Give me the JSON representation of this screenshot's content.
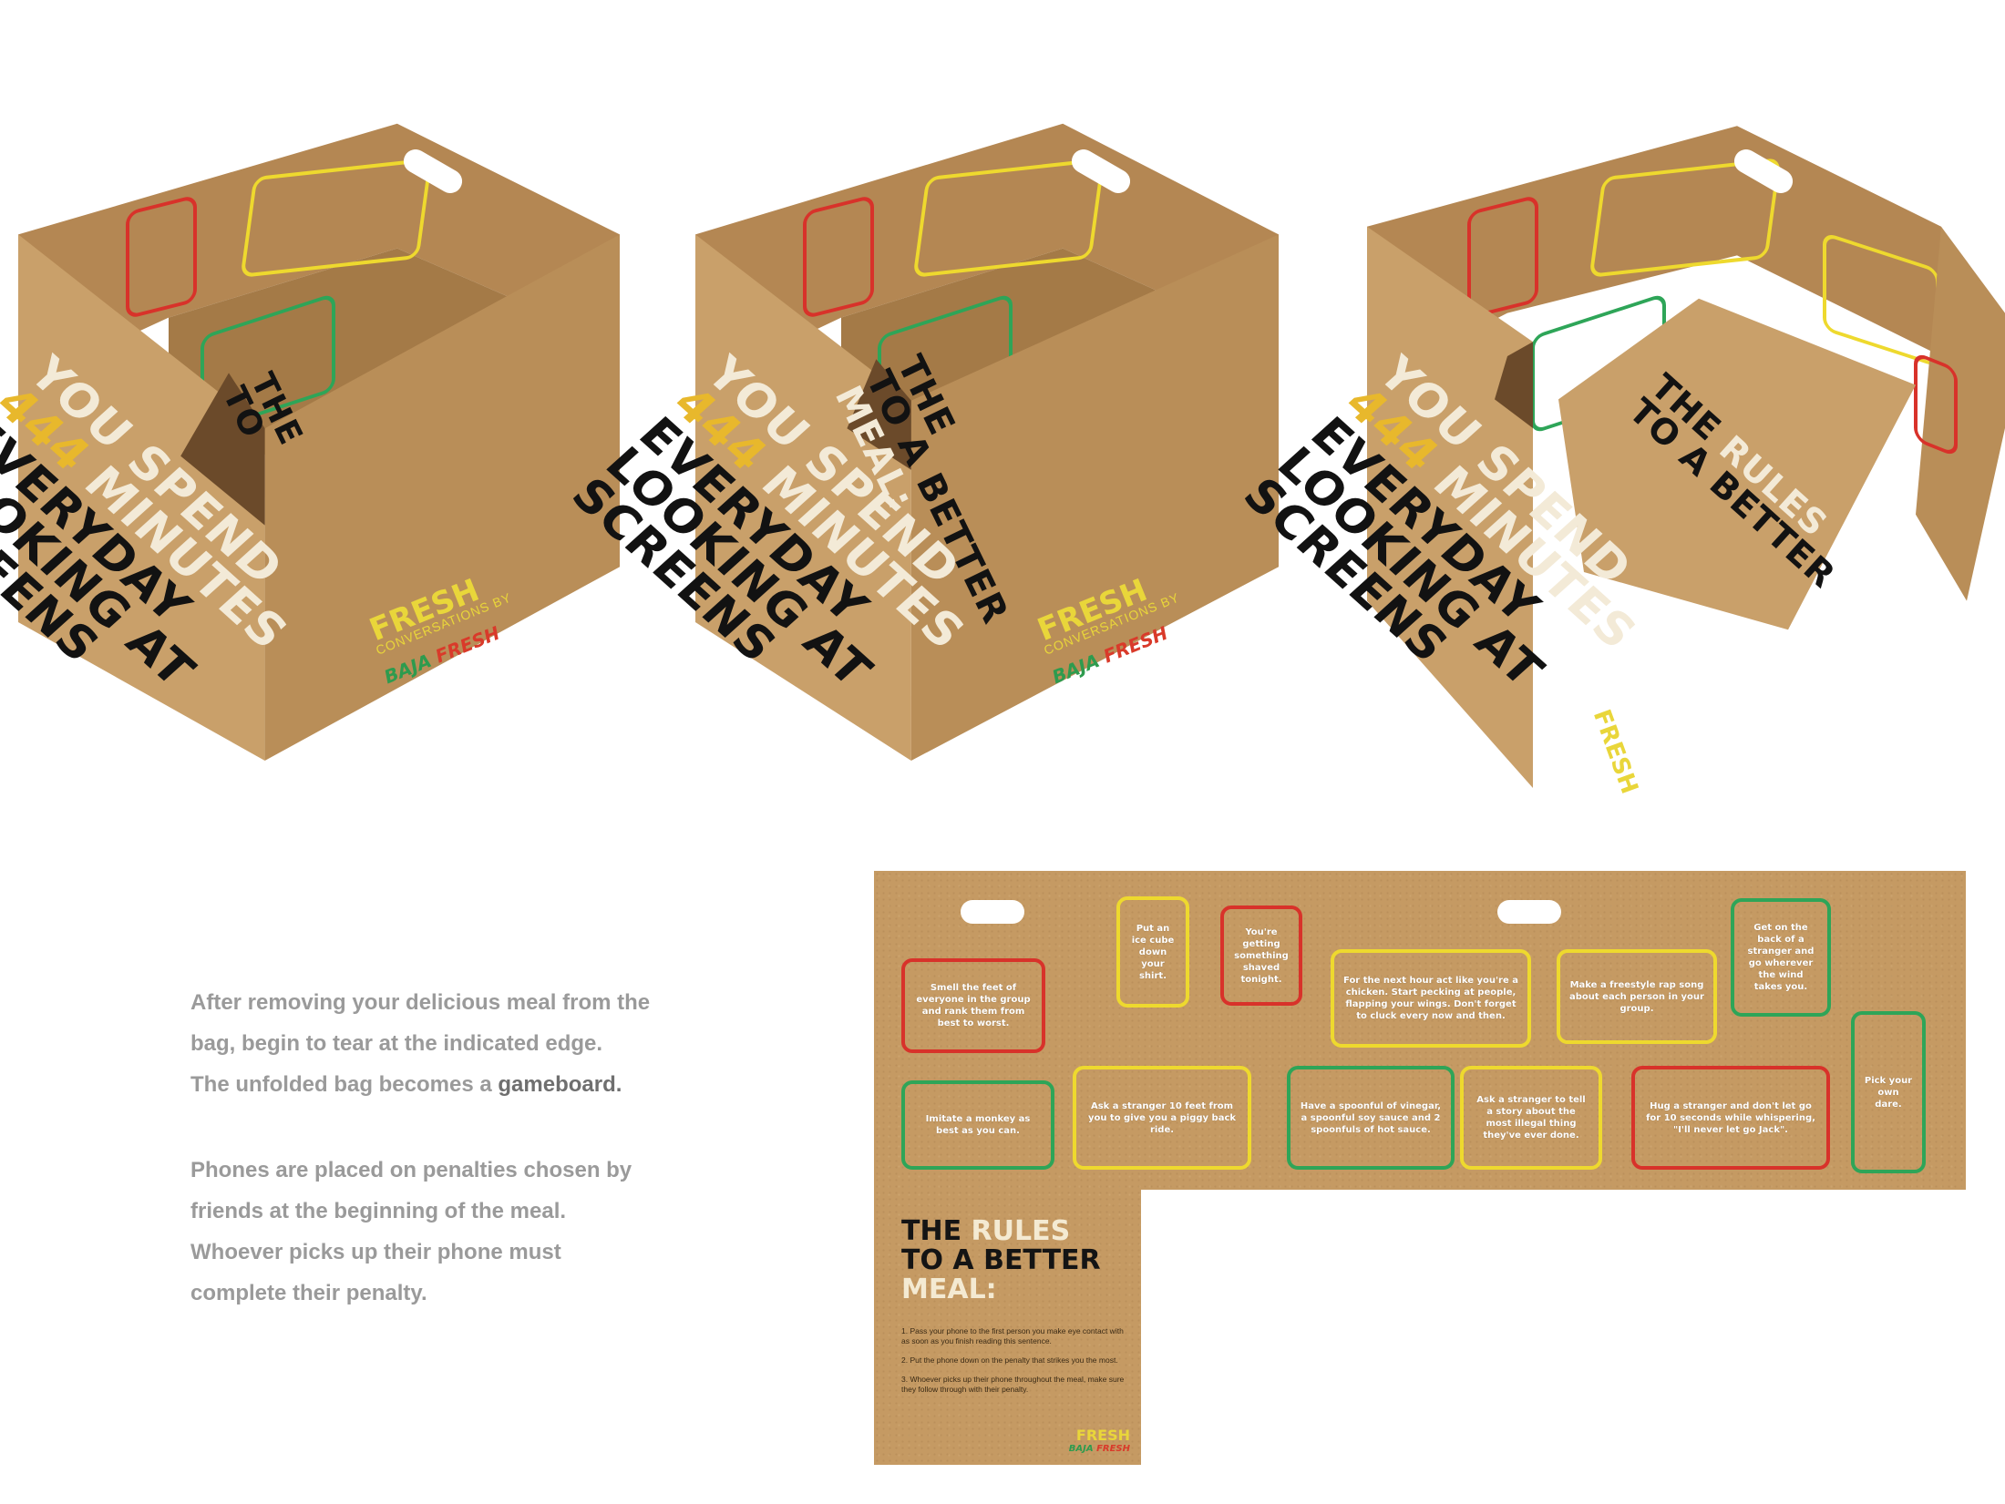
{
  "box_panel": {
    "headline_line1": "YOU SPEND",
    "headline_number": "444",
    "headline_line2": "MINUTES",
    "headline_line3": "EVERYDAY",
    "headline_line4": "LOOKING AT",
    "headline_line5": "SCREENS",
    "logo_fresh": "FRESH",
    "logo_sub": "CONVERSATIONS BY",
    "logo_baja": "BAJA",
    "logo_baja_fresh": "FRESH",
    "inner_title_the": "THE",
    "inner_title_to": "TO",
    "inner_title_rules": "RULES",
    "inner_title_better": "TO A BETTER",
    "inner_title_meal": "MEAL:"
  },
  "description": {
    "para1_lines": [
      "After removing your delicious meal from the",
      "bag, begin to tear at the indicated edge.",
      "The unfolded bag becomes a"
    ],
    "para1_bold": "gameboard.",
    "para2_lines": [
      "Phones are placed on penalties chosen by",
      "friends at the beginning of the meal.",
      "Whoever picks up their phone must",
      "complete their penalty."
    ]
  },
  "gameboard": {
    "cards": {
      "c1": "Smell the feet of everyone in the group and rank them from best to worst.",
      "c2": "Put an ice cube down your shirt.",
      "c3": "You're getting something shaved tonight.",
      "c4": "For the next hour act like you're a chicken. Start pecking at people, flapping your wings. Don't forget to cluck every now and then.",
      "c5": "Make a freestyle rap song about each person in your group.",
      "c6": "Get on the back of a stranger and go wherever the wind takes you.",
      "c7": "Imitate a monkey as best as you can.",
      "c8": "Ask a stranger 10 feet from you to give you a piggy back ride.",
      "c9": "Have a spoonful of vinegar, a spoonful soy sauce and 2 spoonfuls of hot sauce.",
      "c10": "Ask a stranger to tell a story about the most illegal thing they've ever done.",
      "c11": "Hug a stranger and don't let go for 10 seconds while whispering, \"I'll never let go Jack\".",
      "c12": "Pick your own dare."
    },
    "rules_the": "THE",
    "rules_rules": "RULES",
    "rules_line2": "TO A BETTER",
    "rules_line3": "MEAL:",
    "rules": [
      "1. Pass your phone to the first person you make eye contact with as soon as you finish reading this sentence.",
      "2. Put the phone down on the penalty that strikes you the most.",
      "3. Whoever picks up their phone throughout the meal, make sure they follow through with their penalty."
    ],
    "logo_fresh": "FRESH",
    "logo_baja": "BAJA",
    "logo_baja_fresh": "FRESH"
  },
  "colors": {
    "kraft": "#c59a63",
    "red": "#d8322a",
    "yellow": "#eed92e",
    "green": "#2ea558",
    "text_gray": "#9a9a9a"
  }
}
